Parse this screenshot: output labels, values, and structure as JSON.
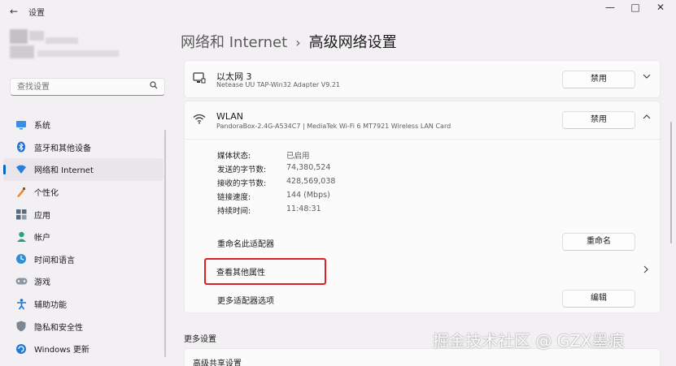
{
  "window": {
    "title": "设置",
    "back": "←",
    "minimize": "—",
    "maximize": "□",
    "close": "✕"
  },
  "search": {
    "placeholder": "查找设置",
    "icon": "search-icon"
  },
  "sidebar": {
    "items": [
      {
        "label": "系统",
        "icon": "system-icon"
      },
      {
        "label": "蓝牙和其他设备",
        "icon": "bluetooth-icon"
      },
      {
        "label": "网络和 Internet",
        "icon": "network-icon",
        "active": true
      },
      {
        "label": "个性化",
        "icon": "personalization-icon"
      },
      {
        "label": "应用",
        "icon": "apps-icon"
      },
      {
        "label": "帐户",
        "icon": "account-icon"
      },
      {
        "label": "时间和语言",
        "icon": "time-language-icon"
      },
      {
        "label": "游戏",
        "icon": "gaming-icon"
      },
      {
        "label": "辅助功能",
        "icon": "accessibility-icon"
      },
      {
        "label": "隐私和安全性",
        "icon": "privacy-icon"
      },
      {
        "label": "Windows 更新",
        "icon": "windows-update-icon"
      }
    ]
  },
  "breadcrumb": {
    "parent": "网络和 Internet",
    "separator": "›",
    "current": "高级网络设置"
  },
  "adapters": {
    "ethernet": {
      "name": "以太网 3",
      "description": "Netease UU TAP-Win32 Adapter V9.21",
      "button": "禁用",
      "chevron": "⌄"
    },
    "wlan": {
      "name": "WLAN",
      "description": "PandoraBox-2.4G-A534C7 | MediaTek Wi-Fi 6 MT7921 Wireless LAN Card",
      "button": "禁用",
      "chevron": "⌃",
      "properties": [
        {
          "label": "媒体状态:",
          "value": "已启用"
        },
        {
          "label": "发送的字节数:",
          "value": "74,380,524"
        },
        {
          "label": "接收的字节数:",
          "value": "428,569,038"
        },
        {
          "label": "链接速度:",
          "value": "144 (Mbps)"
        },
        {
          "label": "持续时间:",
          "value": "11:48:31"
        }
      ],
      "rename_label": "重命名此适配器",
      "rename_button": "重命名",
      "view_more_label": "查看其他属性",
      "view_more_chevron": "›",
      "more_options_label": "更多适配器选项",
      "edit_button": "编辑"
    }
  },
  "more_settings": {
    "title": "更多设置",
    "item": "高级共享设置"
  },
  "watermark": "掘金技术社区 @ GZX墨痕",
  "colors": {
    "accent": "#0067c0",
    "highlight": "#e02020",
    "background": "#f3f0f3",
    "card": "#fbfbfb"
  }
}
